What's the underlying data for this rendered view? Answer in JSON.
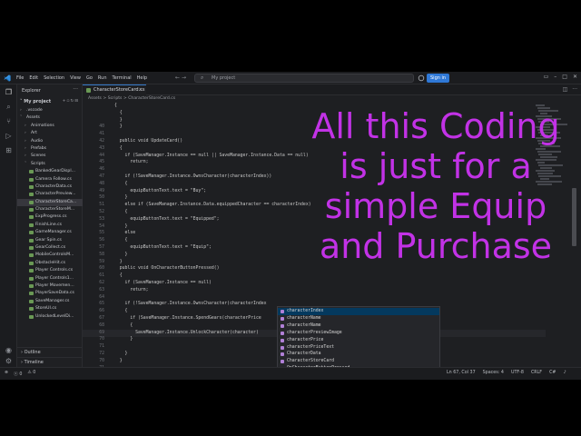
{
  "menu": [
    "File",
    "Edit",
    "Selection",
    "View",
    "Go",
    "Run",
    "Terminal",
    "Help"
  ],
  "search_text": "My project",
  "signin_label": "Sign in",
  "explorer": {
    "title": "Explorer",
    "root": "My project",
    "items": [
      {
        "label": ".vscode",
        "depth": 1,
        "type": "folder",
        "open": false
      },
      {
        "label": "Assets",
        "depth": 1,
        "type": "folder",
        "open": true
      },
      {
        "label": "Animations",
        "depth": 2,
        "type": "folder",
        "open": false
      },
      {
        "label": "Art",
        "depth": 2,
        "type": "folder",
        "open": false
      },
      {
        "label": "Audio",
        "depth": 2,
        "type": "folder",
        "open": false
      },
      {
        "label": "Prefabs",
        "depth": 2,
        "type": "folder",
        "open": false
      },
      {
        "label": "Scenes",
        "depth": 2,
        "type": "folder",
        "open": false
      },
      {
        "label": "Scripts",
        "depth": 2,
        "type": "folder",
        "open": true
      },
      {
        "label": "BankedGearDispl...",
        "depth": 3,
        "type": "file"
      },
      {
        "label": "Camera Follow.cs",
        "depth": 3,
        "type": "file"
      },
      {
        "label": "CharacterData.cs",
        "depth": 3,
        "type": "file"
      },
      {
        "label": "CharacterPreview...",
        "depth": 3,
        "type": "file"
      },
      {
        "label": "CharacterStoreCa...",
        "depth": 3,
        "type": "file",
        "selected": true
      },
      {
        "label": "CharacterStoreM...",
        "depth": 3,
        "type": "file"
      },
      {
        "label": "ExpProgress.cs",
        "depth": 3,
        "type": "file"
      },
      {
        "label": "FinishLine.cs",
        "depth": 3,
        "type": "file"
      },
      {
        "label": "GameManager.cs",
        "depth": 3,
        "type": "file"
      },
      {
        "label": "Gear Spin.cs",
        "depth": 3,
        "type": "file"
      },
      {
        "label": "GearCollect.cs",
        "depth": 3,
        "type": "file"
      },
      {
        "label": "MobileControlsM...",
        "depth": 3,
        "type": "file"
      },
      {
        "label": "ObstacleHit.cs",
        "depth": 3,
        "type": "file"
      },
      {
        "label": "Player Controls.cs",
        "depth": 3,
        "type": "file"
      },
      {
        "label": "Player Controls1...",
        "depth": 3,
        "type": "file"
      },
      {
        "label": "Player Movemen...",
        "depth": 3,
        "type": "file"
      },
      {
        "label": "PlayerSaveData.cs",
        "depth": 3,
        "type": "file"
      },
      {
        "label": "SaveManager.cs",
        "depth": 3,
        "type": "file"
      },
      {
        "label": "StoreUI.cs",
        "depth": 3,
        "type": "file"
      },
      {
        "label": "UnlockedLevelDi...",
        "depth": 3,
        "type": "file"
      }
    ],
    "outline_label": "Outline",
    "timeline_label": "Timeline"
  },
  "tab": {
    "label": "CharacterStoreCard.cs"
  },
  "breadcrumb": "Assets > Scripts > CharacterStoreCard.cs",
  "code_lines": [
    {
      "num": "",
      "text": "{"
    },
    {
      "num": "",
      "text": "  {"
    },
    {
      "num": "",
      "text": "  }"
    },
    {
      "num": "40",
      "text": "  }"
    },
    {
      "num": "41",
      "text": ""
    },
    {
      "num": "42",
      "text": "  public void UpdateCard()"
    },
    {
      "num": "43",
      "text": "  {"
    },
    {
      "num": "44",
      "text": "    if (SaveManager.Instance == null || SaveManager.Instance.Data == null)"
    },
    {
      "num": "45",
      "text": "      return;"
    },
    {
      "num": "46",
      "text": ""
    },
    {
      "num": "47",
      "text": "    if (!SaveManager.Instance.OwnsCharacter(characterIndex))"
    },
    {
      "num": "48",
      "text": "    {"
    },
    {
      "num": "49",
      "text": "      equipButtonText.text = \"Buy\";"
    },
    {
      "num": "50",
      "text": "    }"
    },
    {
      "num": "51",
      "text": "    else if (SaveManager.Instance.Data.equippedCharacter == characterIndex)"
    },
    {
      "num": "52",
      "text": "    {"
    },
    {
      "num": "53",
      "text": "      equipButtonText.text = \"Equipped\";"
    },
    {
      "num": "54",
      "text": "    }"
    },
    {
      "num": "55",
      "text": "    else"
    },
    {
      "num": "56",
      "text": "    {"
    },
    {
      "num": "57",
      "text": "      equipButtonText.text = \"Equip\";"
    },
    {
      "num": "58",
      "text": "    }"
    },
    {
      "num": "59",
      "text": "  }"
    },
    {
      "num": "60",
      "text": "  public void OnCharacterButtonPressed()"
    },
    {
      "num": "61",
      "text": "  {"
    },
    {
      "num": "62",
      "text": "    if (SaveManager.Instance == null)"
    },
    {
      "num": "63",
      "text": "      return;"
    },
    {
      "num": "64",
      "text": ""
    },
    {
      "num": "65",
      "text": "    if (!SaveManager.Instance.OwnsCharacter(characterIndex"
    },
    {
      "num": "66",
      "text": "    {"
    },
    {
      "num": "67",
      "text": "      if (SaveManager.Instance.SpendGears(characterPrice"
    },
    {
      "num": "68",
      "text": "      {"
    },
    {
      "num": "69",
      "text": "        SaveManager.Instance.UnlockCharacter(character)"
    },
    {
      "num": "70",
      "text": "      }"
    },
    {
      "num": "71",
      "text": ""
    },
    {
      "num": "72",
      "text": "    }"
    },
    {
      "num": "70",
      "text": "  }"
    },
    {
      "num": "71",
      "text": ""
    },
    {
      "num": "72",
      "text": "  public RawImage GetPreviewImage()"
    }
  ],
  "suggestions": [
    "characterIndex",
    "characterName",
    "characterName",
    "characterPreviewImage",
    "characterPrice",
    "characterPriceText",
    "CharacterData",
    "CharacterStoreCard",
    "OnCharacterButtonPressed",
    "OwnsCharacter",
    "UnlockCharacter",
    "equippedCharacter"
  ],
  "status": {
    "errors": "0",
    "warnings": "0",
    "position": "Ln 67, Col 37",
    "spaces": "Spaces: 4",
    "encoding": "UTF-8",
    "eol": "CRLF",
    "language": "C#"
  },
  "overlay_lines": [
    "All this Coding",
    "is just for a",
    "simple Equip",
    "and Purchase"
  ],
  "colors": {
    "overlay": "#c232e6",
    "accent": "#2f78d6"
  }
}
